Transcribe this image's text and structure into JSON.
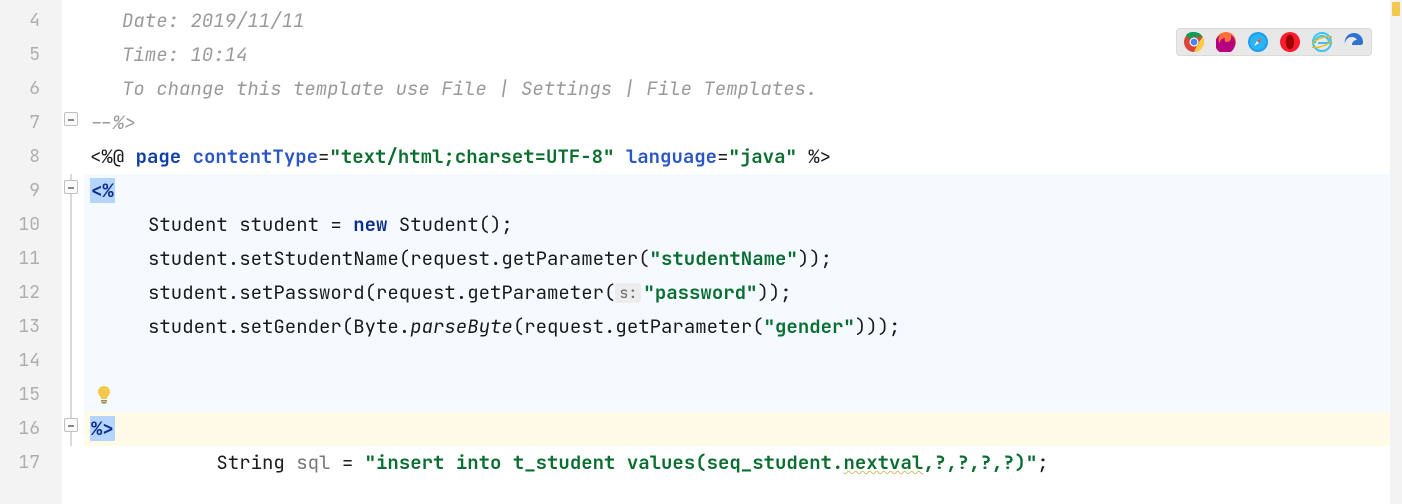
{
  "lines": {
    "start": 4,
    "end": 17
  },
  "comment": {
    "date": "Date: 2019/11/11",
    "time": "Time: 10:14",
    "template_hint": "To change this template use File | Settings | File Templates.",
    "close": "--%>"
  },
  "directive": {
    "open": "<%@ ",
    "page_kw": "page",
    "attr1": "contentType",
    "eq": "=",
    "val1": "\"text/html;charset=UTF-8\"",
    "attr2": "language",
    "val2": "\"java\"",
    "close": " %>"
  },
  "scriptlet": {
    "open": "<%",
    "close": "%>",
    "l1a": "Student student = ",
    "l1_new": "new",
    "l1b": " Student();",
    "l2a": "student.setStudentName(request.getParameter(",
    "l2_str": "\"studentName\"",
    "l2b": "));",
    "l3a": "student.setPassword(request.getParameter(",
    "l3_hint": "s:",
    "l3_str": "\"password\"",
    "l3b": "));",
    "l4a": "student.setGender(Byte.",
    "l4_pb": "parseByte",
    "l4b": "(request.getParameter(",
    "l4_str": "\"gender\"",
    "l4c": ")));",
    "l5a": "String ",
    "l5_var": "sql",
    "l5b": " = ",
    "l5_str_a": "\"insert into t_student values(seq_student.",
    "l5_str_wavy": "nextval",
    "l5_str_b": ",?,?,?,?)\"",
    "l5c": ";"
  },
  "browsers": [
    "chrome",
    "firefox",
    "safari",
    "opera",
    "ie",
    "edge"
  ]
}
